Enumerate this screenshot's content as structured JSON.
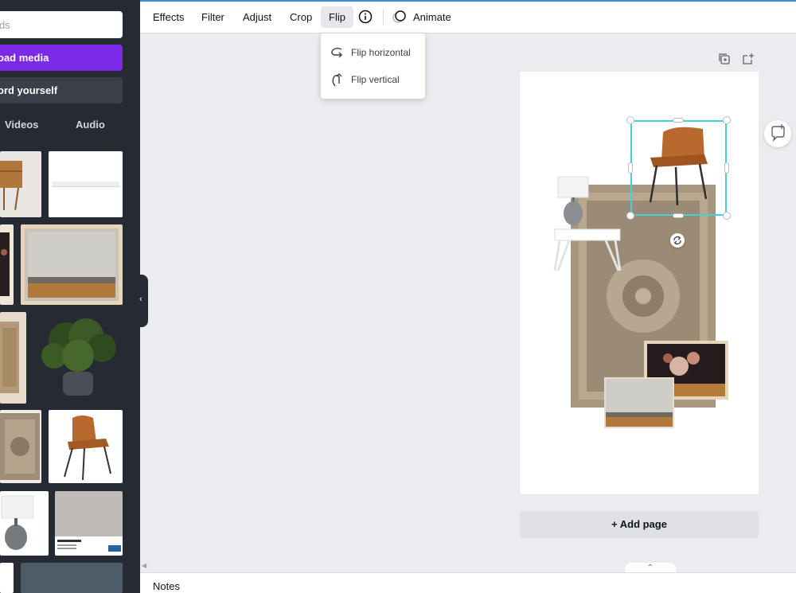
{
  "sidebar": {
    "search_placeholder": "ds",
    "upload_label": "oad media",
    "record_label": "ord yourself",
    "tabs": [
      "Videos",
      "Audio"
    ]
  },
  "toolbar": {
    "effects": "Effects",
    "filter": "Filter",
    "adjust": "Adjust",
    "crop": "Crop",
    "flip": "Flip",
    "animate": "Animate"
  },
  "flip_menu": {
    "horizontal": "Flip horizontal",
    "vertical": "Flip vertical"
  },
  "canvas": {
    "add_page": "+ Add page"
  },
  "notes": {
    "label": "Notes"
  },
  "colors": {
    "accent_purple": "#7d2ae8",
    "selection_cyan": "#3fd3d9",
    "sidebar_bg": "#252a33"
  }
}
